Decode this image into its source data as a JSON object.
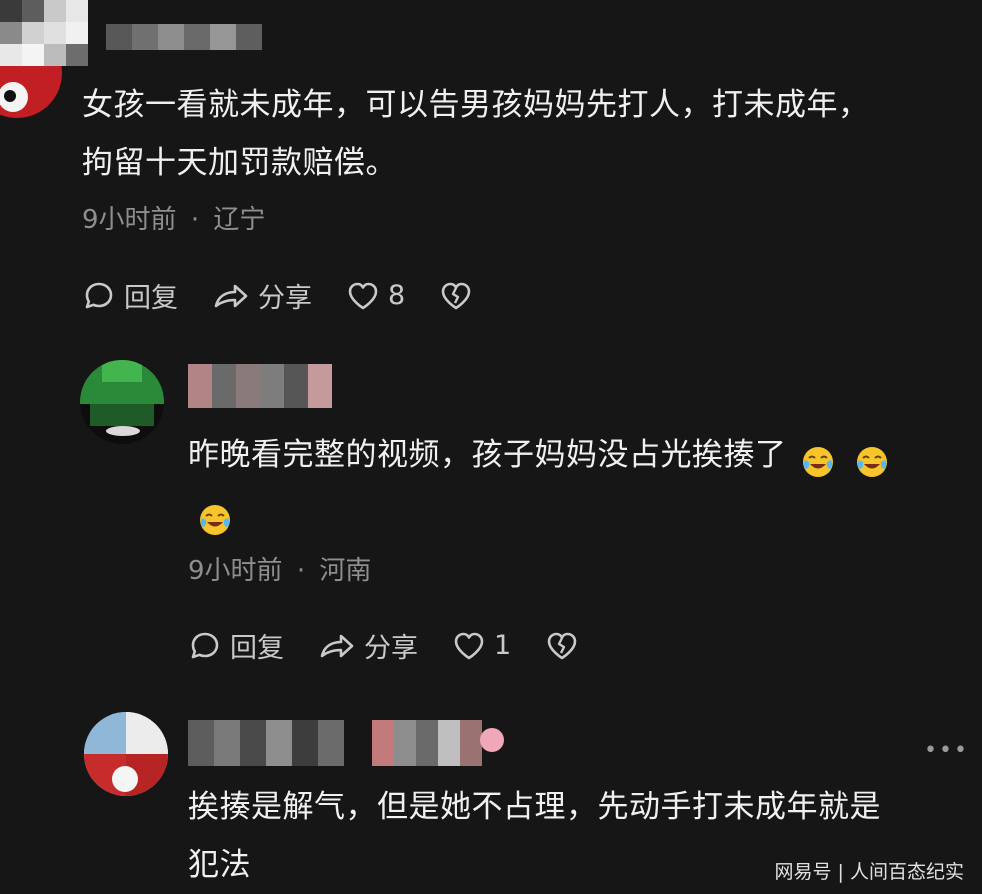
{
  "comments": [
    {
      "text": "女孩一看就未成年，可以告男孩妈妈先打人，打未成年，拘留十天加罚款赔偿。",
      "line1": "女孩一看就未成年，可以告男孩妈妈先打人，打未成年，",
      "line2": "拘留十天加罚款赔偿。",
      "time": "9小时前",
      "location": "辽宁",
      "reply_label": "回复",
      "share_label": "分享",
      "likes": "8"
    },
    {
      "text": "昨晚看完整的视频，孩子妈妈没占光挨揍了",
      "line1": "昨晚看完整的视频，孩子妈妈没占光挨揍了",
      "time": "9小时前",
      "location": "河南",
      "reply_label": "回复",
      "share_label": "分享",
      "likes": "1",
      "emoji": "crying-laughing-face-icon"
    },
    {
      "text": "挨揍是解气，但是她不占理，先动手打未成年就是犯法",
      "line1": "挨揍是解气，但是她不占理，先动手打未成年就是",
      "line2": "犯法"
    }
  ],
  "separator": "·",
  "more_menu": "•••",
  "watermark": "网易号 | 人间百态纪实"
}
